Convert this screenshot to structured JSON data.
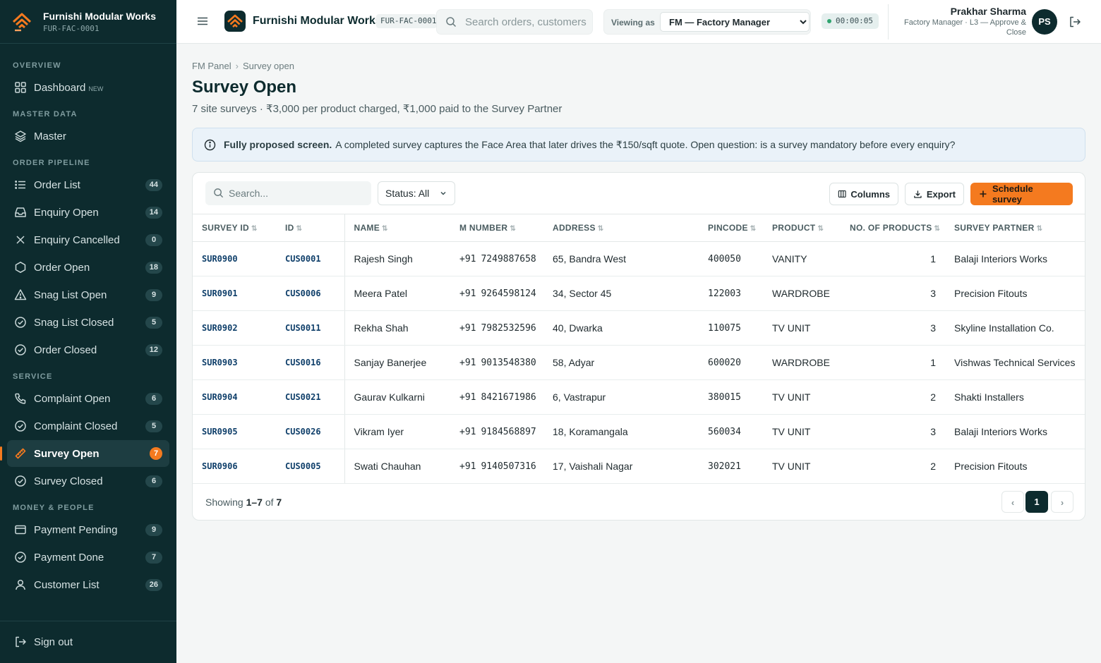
{
  "app": {
    "brand_name": "Furnishi Modular Works",
    "brand_code": "FUR-FAC-0001"
  },
  "sidebar": {
    "sections": {
      "overview": "OVERVIEW",
      "master_data": "MASTER DATA",
      "order_pipeline": "ORDER PIPELINE",
      "service": "SERVICE",
      "money_people": "MONEY & PEOPLE"
    },
    "items": [
      {
        "label": "Dashboard",
        "tag": "NEW",
        "icon": "grid-icon"
      },
      {
        "label": "Master",
        "icon": "layers-icon"
      },
      {
        "label": "Order List",
        "badge": "44",
        "icon": "list-icon"
      },
      {
        "label": "Enquiry Open",
        "badge": "14",
        "icon": "inbox-icon"
      },
      {
        "label": "Enquiry Cancelled",
        "badge": "0",
        "icon": "x-icon"
      },
      {
        "label": "Order Open",
        "badge": "18",
        "icon": "hexagon-icon"
      },
      {
        "label": "Snag List Open",
        "badge": "9",
        "icon": "warning-icon"
      },
      {
        "label": "Snag List Closed",
        "badge": "5",
        "icon": "check-circle-icon"
      },
      {
        "label": "Order Closed",
        "badge": "12",
        "icon": "check-circle-icon"
      },
      {
        "label": "Complaint Open",
        "badge": "6",
        "icon": "phone-icon"
      },
      {
        "label": "Complaint Closed",
        "badge": "5",
        "icon": "check-circle-icon"
      },
      {
        "label": "Survey Open",
        "badge": "7",
        "icon": "ruler-icon",
        "active": true
      },
      {
        "label": "Survey Closed",
        "badge": "6",
        "icon": "check-circle-icon"
      },
      {
        "label": "Payment Pending",
        "badge": "9",
        "icon": "wallet-icon"
      },
      {
        "label": "Payment Done",
        "badge": "7",
        "icon": "check-circle-icon"
      },
      {
        "label": "Customer List",
        "badge": "26",
        "icon": "user-icon"
      }
    ],
    "sign_out": "Sign out"
  },
  "topbar": {
    "brand_name": "Furnishi Modular Works",
    "code": "FUR-FAC-0001",
    "search_placeholder": "Search orders, customers",
    "viewing_as_label": "Viewing as",
    "viewing_as_value": "FM — Factory Manager",
    "timer": "00:00:05",
    "user_name": "Prakhar Sharma",
    "user_role": "Factory Manager · L3 — Approve & Close",
    "user_initials": "PS"
  },
  "page": {
    "breadcrumb": [
      "FM Panel",
      "Survey open"
    ],
    "title": "Survey Open",
    "subtitle": "7 site surveys · ₹3,000 per product charged, ₹1,000 paid to the Survey Partner",
    "note_bold": "Fully proposed screen.",
    "note_text": "A completed survey captures the Face Area that later drives the ₹150/sqft quote. Open question: is a survey mandatory before every enquiry?"
  },
  "toolbar": {
    "search_placeholder": "Search...",
    "status_filter": "Status: All",
    "columns_label": "Columns",
    "export_label": "Export",
    "schedule_label": "Schedule survey"
  },
  "table": {
    "headers": [
      "SURVEY ID",
      "ID",
      "NAME",
      "M NUMBER",
      "ADDRESS",
      "PINCODE",
      "PRODUCT",
      "NO. OF PRODUCTS",
      "SURVEY PARTNER"
    ],
    "phone_cc": "+91",
    "rows": [
      {
        "survey_id": "SUR0900",
        "id": "CUS0001",
        "name": "Rajesh Singh",
        "mobile": "7249887658",
        "address": "65, Bandra West",
        "pincode": "400050",
        "product": "VANITY",
        "count": "1",
        "partner": "Balaji Interiors Works"
      },
      {
        "survey_id": "SUR0901",
        "id": "CUS0006",
        "name": "Meera Patel",
        "mobile": "9264598124",
        "address": "34, Sector 45",
        "pincode": "122003",
        "product": "WARDROBE",
        "count": "3",
        "partner": "Precision Fitouts"
      },
      {
        "survey_id": "SUR0902",
        "id": "CUS0011",
        "name": "Rekha Shah",
        "mobile": "7982532596",
        "address": "40, Dwarka",
        "pincode": "110075",
        "product": "TV UNIT",
        "count": "3",
        "partner": "Skyline Installation Co."
      },
      {
        "survey_id": "SUR0903",
        "id": "CUS0016",
        "name": "Sanjay Banerjee",
        "mobile": "9013548380",
        "address": "58, Adyar",
        "pincode": "600020",
        "product": "WARDROBE",
        "count": "1",
        "partner": "Vishwas Technical Services"
      },
      {
        "survey_id": "SUR0904",
        "id": "CUS0021",
        "name": "Gaurav Kulkarni",
        "mobile": "8421671986",
        "address": "6, Vastrapur",
        "pincode": "380015",
        "product": "TV UNIT",
        "count": "2",
        "partner": "Shakti Installers"
      },
      {
        "survey_id": "SUR0905",
        "id": "CUS0026",
        "name": "Vikram Iyer",
        "mobile": "9184568897",
        "address": "18, Koramangala",
        "pincode": "560034",
        "product": "TV UNIT",
        "count": "3",
        "partner": "Balaji Interiors Works"
      },
      {
        "survey_id": "SUR0906",
        "id": "CUS0005",
        "name": "Swati Chauhan",
        "mobile": "9140507316",
        "address": "17, Vaishali Nagar",
        "pincode": "302021",
        "product": "TV UNIT",
        "count": "2",
        "partner": "Precision Fitouts"
      }
    ]
  },
  "footer": {
    "showing_prefix": "Showing",
    "showing_range": "1–7",
    "showing_of": "of",
    "showing_total": "7",
    "current_page": "1"
  },
  "colors": {
    "sidebar_bg": "#0d2b2e",
    "accent": "#f47a1f",
    "id_link": "#0f3f6a",
    "note_bg": "#eaf2f9"
  }
}
